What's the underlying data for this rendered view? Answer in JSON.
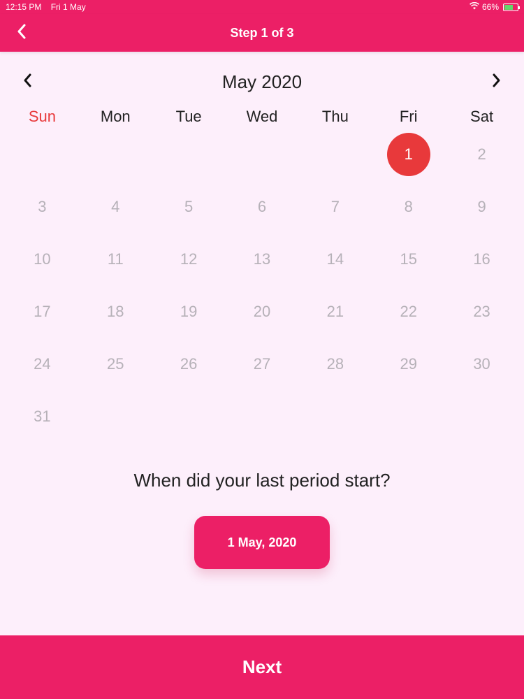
{
  "status_bar": {
    "time": "12:15 PM",
    "date": "Fri 1 May",
    "battery": "66%",
    "battery_level": 0.66
  },
  "nav": {
    "title": "Step 1 of 3",
    "back_icon": "chevron-left-icon"
  },
  "calendar": {
    "month_title": "May 2020",
    "prev_icon": "chevron-left-icon",
    "next_icon": "chevron-right-icon",
    "weekdays": [
      "Sun",
      "Mon",
      "Tue",
      "Wed",
      "Thu",
      "Fri",
      "Sat"
    ],
    "leading_empty_days": 5,
    "days": [
      "1",
      "2",
      "3",
      "4",
      "5",
      "6",
      "7",
      "8",
      "9",
      "10",
      "11",
      "12",
      "13",
      "14",
      "15",
      "16",
      "17",
      "18",
      "19",
      "20",
      "21",
      "22",
      "23",
      "24",
      "25",
      "26",
      "27",
      "28",
      "29",
      "30",
      "31"
    ],
    "selected_day": "1",
    "colors": {
      "sunday_label": "#e8393b",
      "selected_bg": "#e8393b",
      "day_text": "#b6b1b8"
    }
  },
  "question": "When did your last period start?",
  "selected_date_label": "1 May, 2020",
  "next_label": "Next",
  "colors": {
    "accent": "#ec1f66",
    "background": "#fdeffb"
  }
}
